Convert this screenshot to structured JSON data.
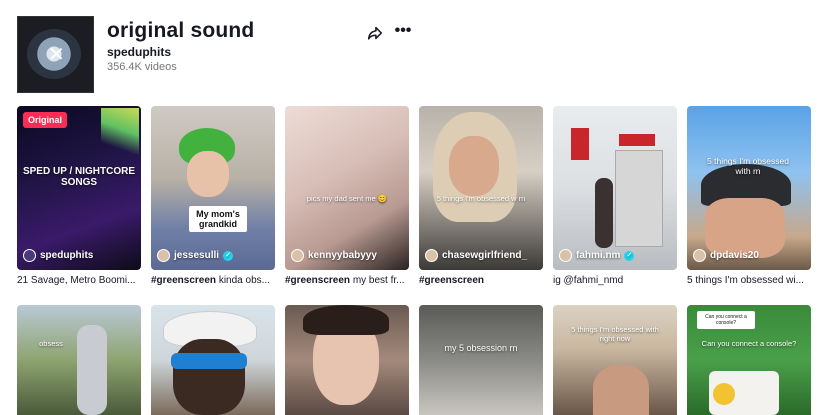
{
  "sound": {
    "title": "original sound",
    "author": "speduphits",
    "videos": "356.4K videos"
  },
  "icons": {
    "share": "share-arrow-icon",
    "more": "more-dots-icon",
    "verified": "verified-check-icon"
  },
  "colors": {
    "badge": "#fe2c55",
    "verified": "#20d5ec"
  },
  "row1": [
    {
      "user": "speduphits",
      "verified": false,
      "badge": "Original",
      "caption_tag": "",
      "caption_text": "21 Savage, Metro Boomi...",
      "overlay": "SPED UP / NIGHTCORE SONGS"
    },
    {
      "user": "jessesulli",
      "verified": true,
      "caption_tag": "#greenscreen",
      "caption_text": " kinda obs...",
      "sticker": "My mom's grandkid"
    },
    {
      "user": "kennyybabyyy",
      "verified": false,
      "caption_tag": "#greenscreen",
      "caption_text": " my best fr...",
      "overlay": "pics my dad sent me 😊"
    },
    {
      "user": "chasewgirlfriend_",
      "verified": false,
      "caption_tag": "#greenscreen",
      "caption_text": "",
      "overlay": "5 things I'm obsessed w rn"
    },
    {
      "user": "fahmi.nm",
      "verified": true,
      "caption_tag": "",
      "caption_text": "ig @fahmi_nmd",
      "overlay": ""
    },
    {
      "user": "dpdavis20",
      "verified": false,
      "caption_tag": "",
      "caption_text": "5 things I'm obsessed wi...",
      "overlay": "5 things I'm obsessed with rn"
    }
  ],
  "row2": [
    {
      "overlay": "obsess"
    },
    {
      "overlay": ""
    },
    {
      "overlay": ""
    },
    {
      "overlay": "my 5 obsession rn"
    },
    {
      "overlay": "5 things I'm obsessed with right now"
    },
    {
      "overlay": "Can you connect a console?",
      "sticker_small": "Can you connect a console?"
    }
  ]
}
